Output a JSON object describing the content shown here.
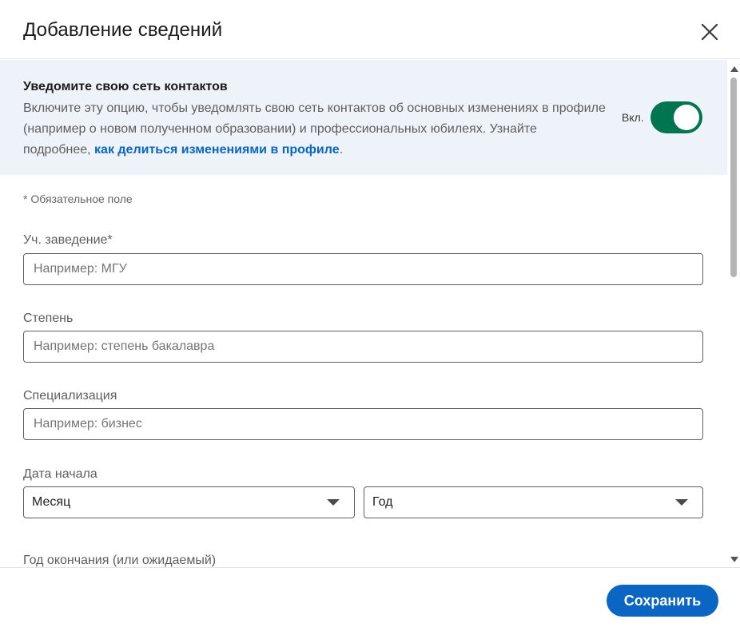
{
  "header": {
    "title": "Добавление сведений",
    "close_icon": "close-icon"
  },
  "notify": {
    "title": "Уведомите свою сеть контактов",
    "text_before": "Включите эту опцию, чтобы уведомлять свою сеть контактов об основных изменениях в профиле (например о новом полученном образовании) и профессиональных юбилеях. Узнайте подробнее, ",
    "link": "как делиться изменениями в профиле",
    "text_after": ".",
    "toggle_label": "Вкл.",
    "toggle_on": true,
    "toggle_color": "#01754f",
    "background": "#edf3f8"
  },
  "form": {
    "required_note": "* Обязательное поле",
    "school": {
      "label": "Уч. заведение*",
      "placeholder": "Например: МГУ",
      "value": ""
    },
    "degree": {
      "label": "Степень",
      "placeholder": "Например: степень бакалавра",
      "value": ""
    },
    "field_of_study": {
      "label": "Специализация",
      "placeholder": "Например: бизнес",
      "value": ""
    },
    "start_date": {
      "label": "Дата начала",
      "month": "Месяц",
      "year": "Год"
    },
    "end_date": {
      "label": "Год окончания (или ожидаемый)"
    }
  },
  "footer": {
    "save_label": "Сохранить",
    "accent": "#0a66c2"
  }
}
